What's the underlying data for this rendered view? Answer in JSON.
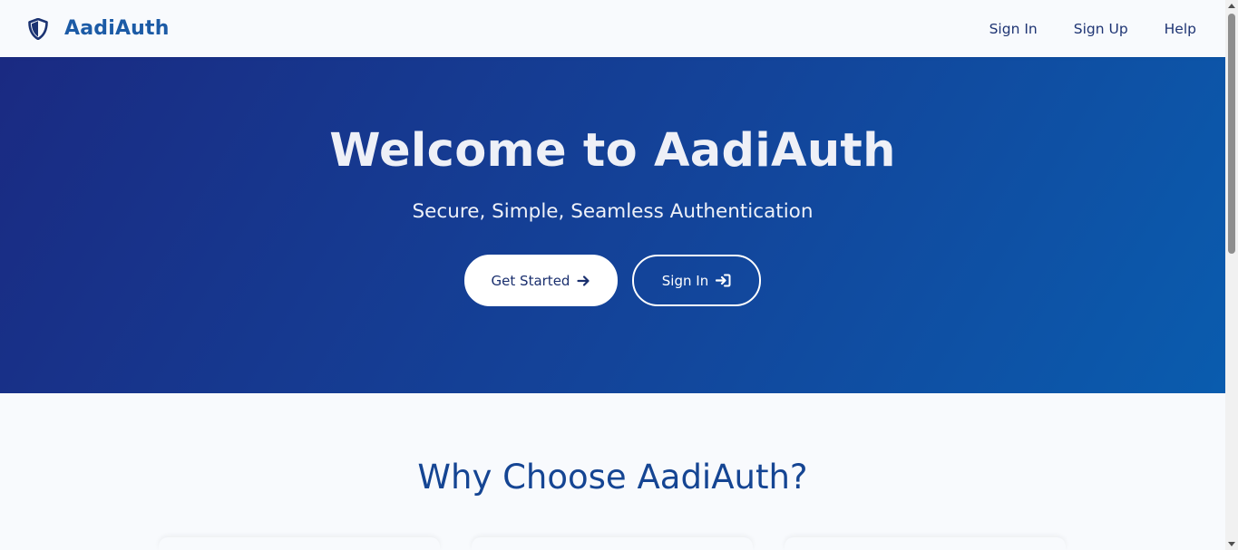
{
  "brand": {
    "name": "AadiAuth",
    "icon": "shield-icon",
    "color": "#1c5ba6"
  },
  "nav": {
    "items": [
      {
        "label": "Sign In"
      },
      {
        "label": "Sign Up"
      },
      {
        "label": "Help"
      }
    ]
  },
  "hero": {
    "title": "Welcome to AadiAuth",
    "subtitle": "Secure, Simple, Seamless Authentication",
    "primary_button": {
      "label": "Get Started",
      "icon": "arrow-right-icon"
    },
    "secondary_button": {
      "label": "Sign In",
      "icon": "sign-in-icon"
    },
    "gradient_start": "#1a2a82",
    "gradient_end": "#0a5cae"
  },
  "features": {
    "title": "Why Choose AadiAuth?"
  }
}
